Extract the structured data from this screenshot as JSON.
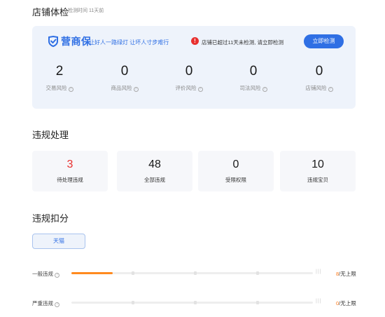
{
  "header": {
    "title": "店铺体检",
    "sub_label": "检测时间",
    "sub_time": "11天前"
  },
  "checkup": {
    "brand_name": "营商保",
    "slogan": "让好人一路绿灯 让坏人寸步难行",
    "warning_text": "店铺已超过11天未检测, 请立即检测",
    "check_button": "立即检测",
    "risks": [
      {
        "value": "2",
        "label": "交易风险"
      },
      {
        "value": "0",
        "label": "商品风险"
      },
      {
        "value": "0",
        "label": "评价风险"
      },
      {
        "value": "0",
        "label": "司法风险"
      },
      {
        "value": "0",
        "label": "店铺风险"
      }
    ]
  },
  "violations": {
    "title": "违规处理",
    "stats": [
      {
        "value": "3",
        "label": "待处理违规"
      },
      {
        "value": "48",
        "label": "全部违规"
      },
      {
        "value": "0",
        "label": "受限权限"
      },
      {
        "value": "10",
        "label": "违规宝贝"
      }
    ]
  },
  "deductions": {
    "title": "违规扣分",
    "tab": "天猫",
    "rows": [
      {
        "label": "一般违规",
        "count": "8",
        "limit_suffix": "/无上限",
        "progress": 0.17
      },
      {
        "label": "严重违规",
        "count": "0",
        "limit_suffix": "/无上限",
        "progress": 0
      }
    ]
  },
  "colors": {
    "accent": "#2f6fe4",
    "danger": "#e8302f",
    "progress": "#ff8a1f"
  }
}
